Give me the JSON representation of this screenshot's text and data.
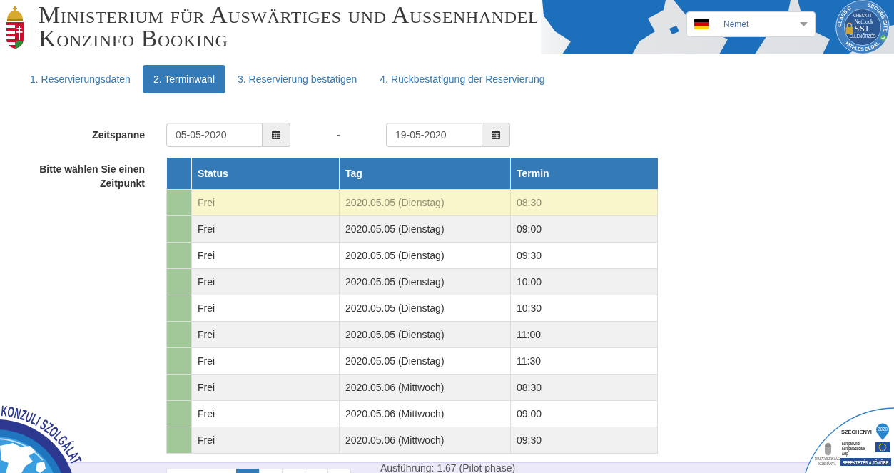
{
  "header": {
    "title": "Ministerium für Auswärtiges und Aussenhandel",
    "subtitle": "Konzinfo Booking",
    "language": {
      "value": "Német"
    },
    "ssl_badge": {
      "ring_left": "CLASS C",
      "ring_right": "SECURE SITE",
      "line_1": "CHECK IT",
      "line_2": "NetLock",
      "line_3": "SSL",
      "line_4": "ELLENŐRZÉS",
      "ring_bottom": "HITELES OLDAL"
    }
  },
  "steps": [
    {
      "label": "1. Reservierungsdaten",
      "selected": false
    },
    {
      "label": "2. Terminwahl",
      "selected": true
    },
    {
      "label": "3. Reservierung bestätigen",
      "selected": false
    },
    {
      "label": "4. Rückbestätigung der Reservierung",
      "selected": false
    }
  ],
  "form": {
    "period_label": "Zeitspanne",
    "date_from": "05-05-2020",
    "separator": "-",
    "date_to": "19-05-2020",
    "slot_label": "Bitte wählen Sie einen Zeitpunkt"
  },
  "table": {
    "columns": [
      "Status",
      "Tag",
      "Termin"
    ],
    "rows": [
      {
        "status": "Frei",
        "day": "2020.05.05 (Dienstag)",
        "time": "08:30",
        "selected": true,
        "color": "#a2c89a"
      },
      {
        "status": "Frei",
        "day": "2020.05.05 (Dienstag)",
        "time": "09:00",
        "selected": false,
        "color": "#a2c89a"
      },
      {
        "status": "Frei",
        "day": "2020.05.05 (Dienstag)",
        "time": "09:30",
        "selected": false,
        "color": "#a2c89a"
      },
      {
        "status": "Frei",
        "day": "2020.05.05 (Dienstag)",
        "time": "10:00",
        "selected": false,
        "color": "#a2c89a"
      },
      {
        "status": "Frei",
        "day": "2020.05.05 (Dienstag)",
        "time": "10:30",
        "selected": false,
        "color": "#a2c89a"
      },
      {
        "status": "Frei",
        "day": "2020.05.05 (Dienstag)",
        "time": "11:00",
        "selected": false,
        "color": "#a2c89a"
      },
      {
        "status": "Frei",
        "day": "2020.05.05 (Dienstag)",
        "time": "11:30",
        "selected": false,
        "color": "#a2c89a"
      },
      {
        "status": "Frei",
        "day": "2020.05.06 (Mittwoch)",
        "time": "08:30",
        "selected": false,
        "color": "#a2c89a"
      },
      {
        "status": "Frei",
        "day": "2020.05.06 (Mittwoch)",
        "time": "09:00",
        "selected": false,
        "color": "#a2c89a"
      },
      {
        "status": "Frei",
        "day": "2020.05.06 (Mittwoch)",
        "time": "09:30",
        "selected": false,
        "color": "#a2c89a"
      }
    ]
  },
  "footer": {
    "pagination": [
      {
        "selected": false
      },
      {
        "selected": true
      },
      {
        "selected": false
      },
      {
        "selected": false
      },
      {
        "selected": false
      },
      {
        "selected": false
      }
    ],
    "version": "Ausführung: 1.67 (Pilot phase)"
  },
  "logos": {
    "consular": {
      "text": "KONZULI SZOLGÁLAT"
    },
    "funding": {
      "title": "SZÉCHENYI",
      "year": "2020",
      "government_lines": [
        "MAGYARORSZÁG",
        "KORMÁNYA"
      ],
      "fund_lines": [
        "Európai Unió",
        "Európai Szociális",
        "Alap"
      ],
      "slogan": "BEFEKTETÉS A JÖVŐBE"
    }
  }
}
